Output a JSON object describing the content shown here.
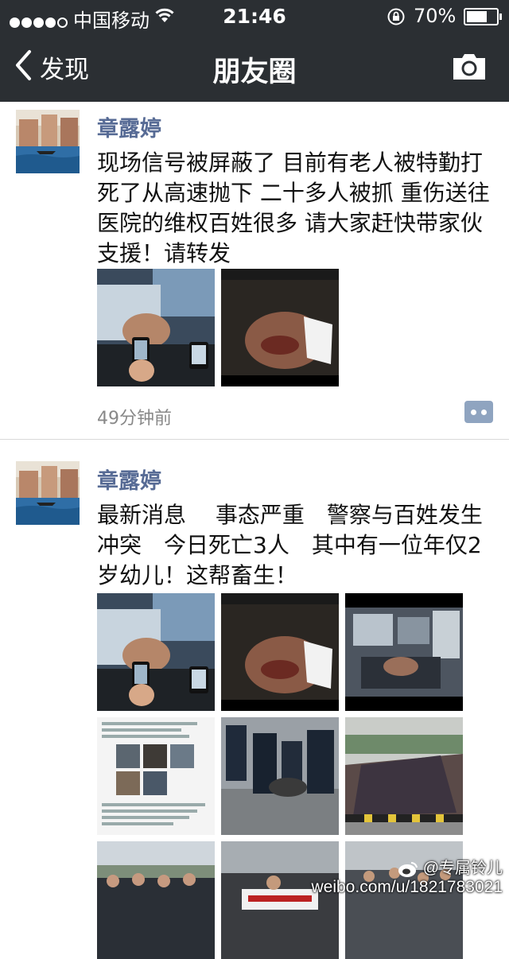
{
  "status_bar": {
    "carrier": "中国移动",
    "time": "21:46",
    "battery": "70%",
    "battery_level": 0.7
  },
  "nav": {
    "back_label": "发现",
    "title": "朋友圈",
    "camera_icon": "camera-icon"
  },
  "posts": [
    {
      "author": "章露婷",
      "text_lines": [
        "现场信号被屏蔽了 目前有老人被特勤打",
        "死了从高速抛下 二十多人被抓 重伤送往",
        "医院的维权百姓很多 请大家赶快带家伙",
        "支援！请转发"
      ],
      "photos": [
        "injured-man-phones-photo",
        "injured-elder-bandaged-photo"
      ],
      "time_ago": "49分钟前"
    },
    {
      "author": "章露婷",
      "text_lines": [
        "最新消息　 事态严重　警察与百姓发生",
        "冲突　今日死亡3人　其中有一位年仅2",
        "岁幼儿！这帮畜生！"
      ],
      "photos": [
        "injured-man-phones-photo",
        "injured-elder-bandaged-photo",
        "ambulance-interior-photo",
        "chat-screenshot-photo",
        "police-arrest-photo",
        "crowd-road-photo",
        "police-line-photo",
        "banner-protest-photo",
        "crowd-roadside-photo"
      ]
    }
  ],
  "watermark": {
    "handle": "@专属铃儿",
    "url": "weibo.com/u/1821783021"
  }
}
